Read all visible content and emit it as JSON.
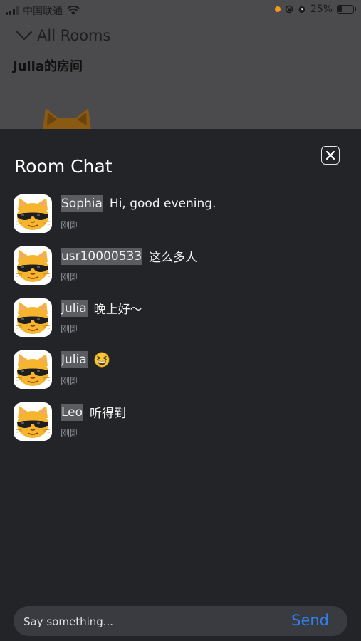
{
  "status_bar": {
    "carrier": "中国联通",
    "battery_percent": "25%",
    "battery_level": 0.25,
    "icons": [
      "signal-icon",
      "wifi-icon",
      "orientation-lock-icon",
      "alarm-icon",
      "battery-icon"
    ]
  },
  "background": {
    "rooms_label": "All Rooms",
    "room_name": "Julia的房间"
  },
  "chat": {
    "title": "Room Chat",
    "messages": [
      {
        "user": "Sophia",
        "text": "Hi, good evening.",
        "time": "刚刚"
      },
      {
        "user": "usr10000533",
        "text": "这么多人",
        "time": "刚刚"
      },
      {
        "user": "Julia",
        "text": "晚上好～",
        "time": "刚刚"
      },
      {
        "user": "Julia",
        "text": "",
        "emoji": "grinning-squinting-face",
        "time": "刚刚"
      },
      {
        "user": "Leo",
        "text": "听得到",
        "time": "刚刚"
      }
    ],
    "input": {
      "value": "",
      "placeholder": "Say something..."
    },
    "send_label": "Send"
  },
  "colors": {
    "panel_bg": "#222428",
    "accent": "#2f80ed",
    "username_bg": "#5b5c60",
    "timestamp": "#8a8c91"
  }
}
